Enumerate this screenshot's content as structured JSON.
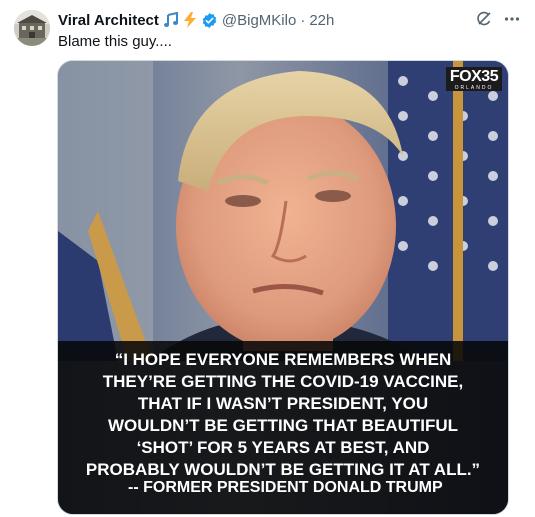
{
  "tweet": {
    "display_name": "Viral Architect",
    "handle": "@BigMKilo",
    "separator": "·",
    "time": "22h",
    "text": "Blame this guy....",
    "emojis": [
      "music-note-icon",
      "lightning-icon"
    ],
    "verified": true
  },
  "media": {
    "logo": {
      "main": "FOX35",
      "sub": "ORLANDO"
    },
    "quote_lines": [
      "“I HOPE EVERYONE REMEMBERS WHEN",
      "THEY’RE GETTING THE COVID-19 VACCINE,",
      "THAT IF I WASN’T PRESIDENT, YOU",
      "WOULDN’T BE GETTING THAT BEAUTIFUL",
      "‘SHOT’ FOR 5 YEARS AT BEST, AND",
      "PROBABLY WOULDN’T BE GETTING IT AT ALL.”"
    ],
    "attribution": "-- FORMER PRESIDENT DONALD TRUMP"
  },
  "colors": {
    "verified_badge": "#1d9bf0",
    "secondary_text": "#536471",
    "emoji_blue": "#3b88c3",
    "emoji_yellow": "#ffac33"
  },
  "icons": {
    "grok": "grok-icon",
    "more": "more-options-icon"
  }
}
